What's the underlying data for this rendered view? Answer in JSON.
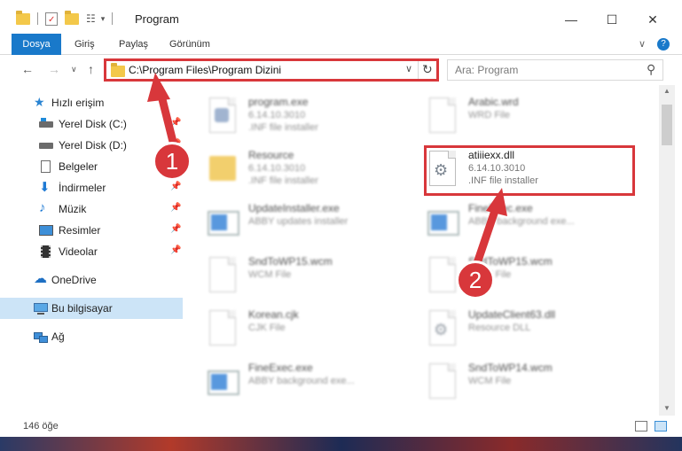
{
  "window": {
    "title": "Program",
    "controls": {
      "minimize": "—",
      "maximize": "☐",
      "close": "✕"
    }
  },
  "ribbon": {
    "tabs": [
      {
        "label": "Dosya"
      },
      {
        "label": "Giriş"
      },
      {
        "label": "Paylaş"
      },
      {
        "label": "Görünüm"
      }
    ],
    "chevron": "∨",
    "help": "?"
  },
  "nav": {
    "back": "←",
    "forward": "→",
    "recent": "∨",
    "up": "↑",
    "address": "C:\\Program Files\\Program Dizini",
    "address_dropdown": "∨",
    "refresh": "↻",
    "search_placeholder": "Ara: Program",
    "search_icon": "⚲"
  },
  "sidebar": {
    "quick_access": "Hızlı erişim",
    "items": [
      {
        "label": "Yerel Disk (C:)",
        "icon": "drive-icon",
        "pinned": true
      },
      {
        "label": "Yerel Disk (D:)",
        "icon": "drive-icon",
        "pinned": true
      },
      {
        "label": "Belgeler",
        "icon": "documents-icon",
        "pinned": true
      },
      {
        "label": "İndirmeler",
        "icon": "downloads-icon",
        "pinned": true
      },
      {
        "label": "Müzik",
        "icon": "music-icon",
        "pinned": true
      },
      {
        "label": "Resimler",
        "icon": "pictures-icon",
        "pinned": true
      },
      {
        "label": "Videolar",
        "icon": "videos-icon",
        "pinned": true
      }
    ],
    "onedrive": "OneDrive",
    "this_pc": "Bu bilgisayar",
    "network": "Ağ",
    "pin_glyph": "📌"
  },
  "files": [
    {
      "name": "program.exe",
      "line1": "6.14.10.3010",
      "line2": ".INF file installer",
      "icon": "installer-icon"
    },
    {
      "name": "Arabic.wrd",
      "line1": "WRD File",
      "line2": "",
      "icon": "document-icon"
    },
    {
      "name": "Resource",
      "line1": "6.14.10.3010",
      "line2": ".INF file installer",
      "icon": "folder-icon"
    },
    {
      "name": "atiiiexx.dll",
      "line1": "6.14.10.3010",
      "line2": ".INF file installer",
      "icon": "dll-gear-icon"
    },
    {
      "name": "UpdateInstaller.exe",
      "line1": "ABBY updates installer",
      "line2": "",
      "icon": "app-window-icon"
    },
    {
      "name": "FineExec.exe",
      "line1": "ABBY background exe...",
      "line2": "",
      "icon": "app-window-icon"
    },
    {
      "name": "SndToWP15.wcm",
      "line1": "WCM File",
      "line2": "",
      "icon": "document-icon"
    },
    {
      "name": "SndToWP15.wcm",
      "line1": "WCM File",
      "line2": "",
      "icon": "document-icon"
    },
    {
      "name": "Korean.cjk",
      "line1": "CJK File",
      "line2": "",
      "icon": "document-icon"
    },
    {
      "name": "UpdateClient63.dll",
      "line1": "Resource DLL",
      "line2": "",
      "icon": "dll-gear-icon"
    },
    {
      "name": "FineExec.exe",
      "line1": "ABBY background exe...",
      "line2": "",
      "icon": "app-window-icon"
    },
    {
      "name": "SndToWP14.wcm",
      "line1": "WCM File",
      "line2": "",
      "icon": "document-icon"
    }
  ],
  "status": {
    "count": "146 öğe"
  },
  "annotations": {
    "step1": "1",
    "step2": "2",
    "color": "#d8373b"
  }
}
